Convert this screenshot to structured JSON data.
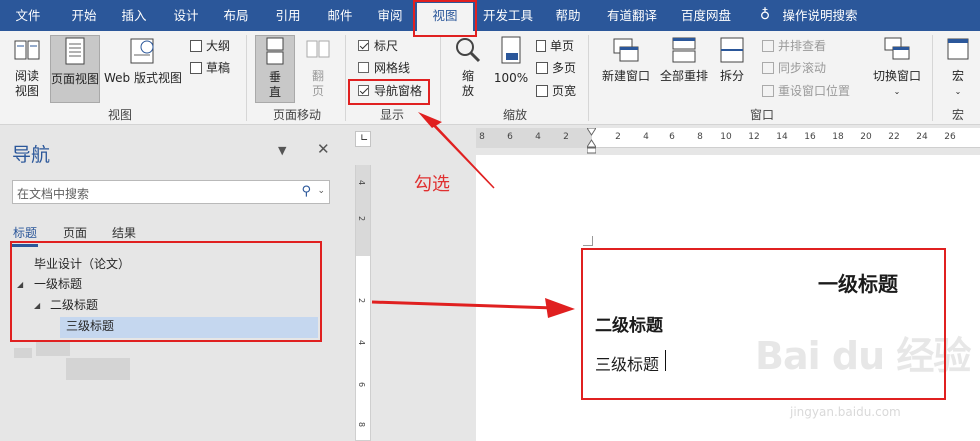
{
  "tabs": [
    {
      "label": "文件",
      "active": false
    },
    {
      "label": "开始",
      "active": false
    },
    {
      "label": "插入",
      "active": false
    },
    {
      "label": "设计",
      "active": false
    },
    {
      "label": "布局",
      "active": false
    },
    {
      "label": "引用",
      "active": false
    },
    {
      "label": "邮件",
      "active": false
    },
    {
      "label": "审阅",
      "active": false
    },
    {
      "label": "视图",
      "active": true
    },
    {
      "label": "开发工具",
      "active": false
    },
    {
      "label": "帮助",
      "active": false
    },
    {
      "label": "有道翻译",
      "active": false
    },
    {
      "label": "百度网盘",
      "active": false
    }
  ],
  "tell_me": "操作说明搜索",
  "ribbon": {
    "view": {
      "reading": "阅读\n视图",
      "print_layout": "页面视图",
      "web_layout": "Web 版式视图",
      "outline": "大纲",
      "draft": "草稿",
      "group_label": "视图"
    },
    "page_move": {
      "vertical": "垂\n直",
      "side_to_side": "翻\n页",
      "group_label": "页面移动"
    },
    "show": {
      "ruler": "标尺",
      "gridlines": "网格线",
      "nav_pane": "导航窗格",
      "ruler_checked": true,
      "gridlines_checked": false,
      "nav_pane_checked": true,
      "group_label": "显示"
    },
    "zoom": {
      "zoom": "缩\n放",
      "hundred": "100%",
      "one_page": "单页",
      "multiple_pages": "多页",
      "page_width": "页宽",
      "group_label": "缩放"
    },
    "window": {
      "new_window": "新建窗口",
      "arrange_all": "全部重排",
      "split": "拆分",
      "side_by_side": "并排查看",
      "sync_scroll": "同步滚动",
      "reset_position": "重设窗口位置",
      "switch_windows": "切换窗口",
      "group_label": "窗口"
    },
    "macros": {
      "macros": "宏",
      "group_label": "宏"
    }
  },
  "nav": {
    "title": "导航",
    "search_placeholder": "在文档中搜索",
    "subtabs": [
      "标题",
      "页面",
      "结果"
    ],
    "tree": [
      {
        "label": "毕业设计（论文）",
        "level": 0
      },
      {
        "label": "一级标题",
        "level": 1
      },
      {
        "label": "二级标题",
        "level": 2
      },
      {
        "label": "三级标题",
        "level": 3
      }
    ]
  },
  "ruler": {
    "h_marks": [
      "8",
      "6",
      "4",
      "2",
      "2",
      "4",
      "6",
      "8",
      "10",
      "12",
      "14",
      "16",
      "18",
      "20",
      "22",
      "24",
      "26",
      "28",
      "30",
      "32"
    ],
    "v_marks": [
      "4",
      "2",
      "2",
      "4",
      "6",
      "8"
    ]
  },
  "document": {
    "h1": "一级标题",
    "h2": "二级标题",
    "h3": "三级标题"
  },
  "annotation": "勾选",
  "watermark": {
    "brand": "Bai du 经验",
    "url": "jingyan.baidu.com"
  },
  "colors": {
    "accent": "#2b579a",
    "annotation_red": "#e02020",
    "selection": "#c5d7ef"
  }
}
